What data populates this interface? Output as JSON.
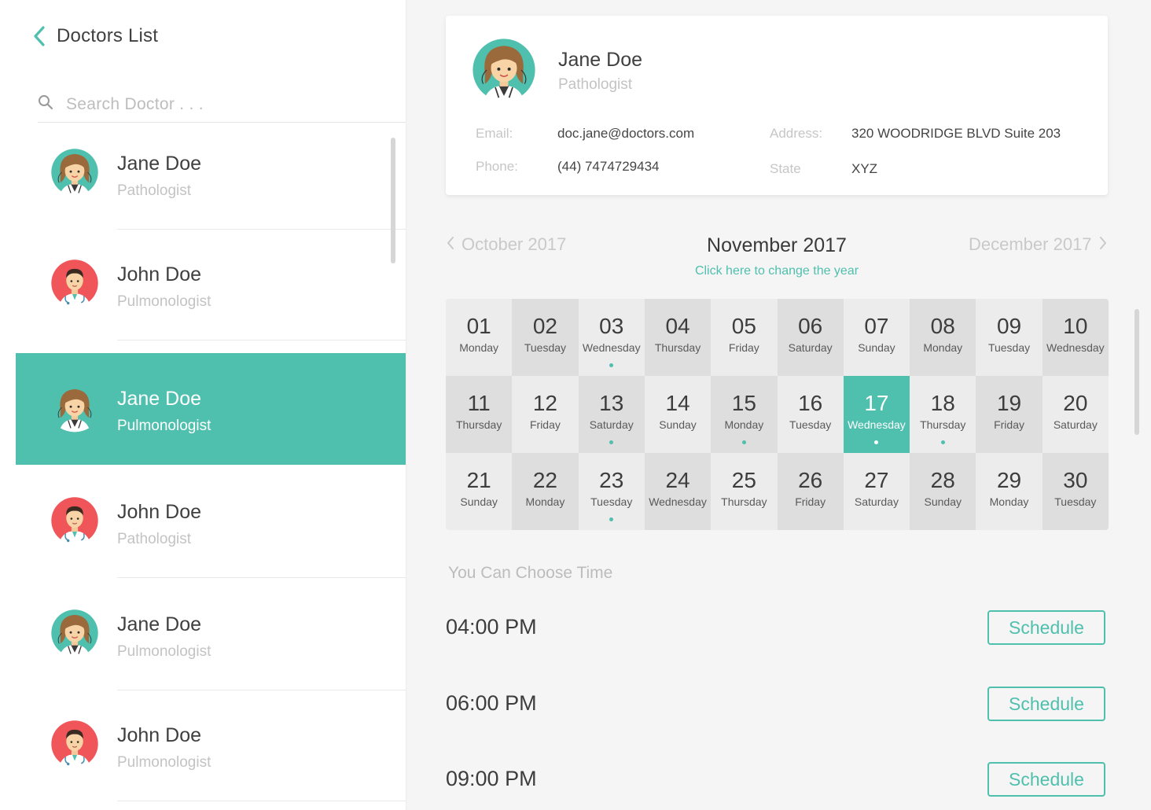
{
  "sidebar": {
    "title": "Doctors List",
    "search": {
      "placeholder": "Search Doctor . . .",
      "value": ""
    },
    "doctors": [
      {
        "name": "Jane Doe",
        "specialty": "Pathologist",
        "avatar": "female-doctor-avatar-icon",
        "selected": false
      },
      {
        "name": "John Doe",
        "specialty": "Pulmonologist",
        "avatar": "male-doctor-avatar-icon",
        "selected": false
      },
      {
        "name": "Jane Doe",
        "specialty": "Pulmonologist",
        "avatar": "female-doctor-avatar-icon",
        "selected": true
      },
      {
        "name": "John Doe",
        "specialty": "Pathologist",
        "avatar": "male-doctor-avatar-icon",
        "selected": false
      },
      {
        "name": "Jane Doe",
        "specialty": "Pulmonologist",
        "avatar": "female-doctor-avatar-icon",
        "selected": false
      },
      {
        "name": "John Doe",
        "specialty": "Pulmonologist",
        "avatar": "male-doctor-avatar-icon",
        "selected": false
      }
    ]
  },
  "profile": {
    "name": "Jane Doe",
    "specialty": "Pathologist",
    "email_label": "Email:",
    "email": "doc.jane@doctors.com",
    "phone_label": "Phone:",
    "phone": "(44) 7474729434",
    "address_label": "Address:",
    "address": "320 WOODRIDGE BLVD Suite 203",
    "state_label": "State",
    "state": "XYZ"
  },
  "calendar": {
    "prev_month": "October 2017",
    "current_month": "November 2017",
    "next_month": "December 2017",
    "change_year_link": "Click here to change the year",
    "selected_day": "17",
    "days": [
      {
        "num": "01",
        "name": "Monday",
        "dot": false
      },
      {
        "num": "02",
        "name": "Tuesday",
        "dot": false
      },
      {
        "num": "03",
        "name": "Wednesday",
        "dot": true
      },
      {
        "num": "04",
        "name": "Thursday",
        "dot": false
      },
      {
        "num": "05",
        "name": "Friday",
        "dot": false
      },
      {
        "num": "06",
        "name": "Saturday",
        "dot": false
      },
      {
        "num": "07",
        "name": "Sunday",
        "dot": false
      },
      {
        "num": "08",
        "name": "Monday",
        "dot": false
      },
      {
        "num": "09",
        "name": "Tuesday",
        "dot": false
      },
      {
        "num": "10",
        "name": "Wednesday",
        "dot": false
      },
      {
        "num": "11",
        "name": "Thursday",
        "dot": false
      },
      {
        "num": "12",
        "name": "Friday",
        "dot": false
      },
      {
        "num": "13",
        "name": "Saturday",
        "dot": true
      },
      {
        "num": "14",
        "name": "Sunday",
        "dot": false
      },
      {
        "num": "15",
        "name": "Monday",
        "dot": true
      },
      {
        "num": "16",
        "name": "Tuesday",
        "dot": false
      },
      {
        "num": "17",
        "name": "Wednesday",
        "dot": true
      },
      {
        "num": "18",
        "name": "Thursday",
        "dot": true
      },
      {
        "num": "19",
        "name": "Friday",
        "dot": false
      },
      {
        "num": "20",
        "name": "Saturday",
        "dot": false
      },
      {
        "num": "21",
        "name": "Sunday",
        "dot": false
      },
      {
        "num": "22",
        "name": "Monday",
        "dot": false
      },
      {
        "num": "23",
        "name": "Tuesday",
        "dot": true
      },
      {
        "num": "24",
        "name": "Wednesday",
        "dot": false
      },
      {
        "num": "25",
        "name": "Thursday",
        "dot": false
      },
      {
        "num": "26",
        "name": "Friday",
        "dot": false
      },
      {
        "num": "27",
        "name": "Saturday",
        "dot": false
      },
      {
        "num": "28",
        "name": "Sunday",
        "dot": false
      },
      {
        "num": "29",
        "name": "Monday",
        "dot": false
      },
      {
        "num": "30",
        "name": "Tuesday",
        "dot": false
      }
    ]
  },
  "times": {
    "heading": "You Can Choose Time",
    "button_label": "Schedule",
    "slots": [
      "04:00 PM",
      "06:00 PM",
      "09:00 PM"
    ]
  },
  "colors": {
    "accent": "#4fbfae",
    "female_avatar_bg": "#4fbfae",
    "male_avatar_bg": "#f0555a"
  }
}
